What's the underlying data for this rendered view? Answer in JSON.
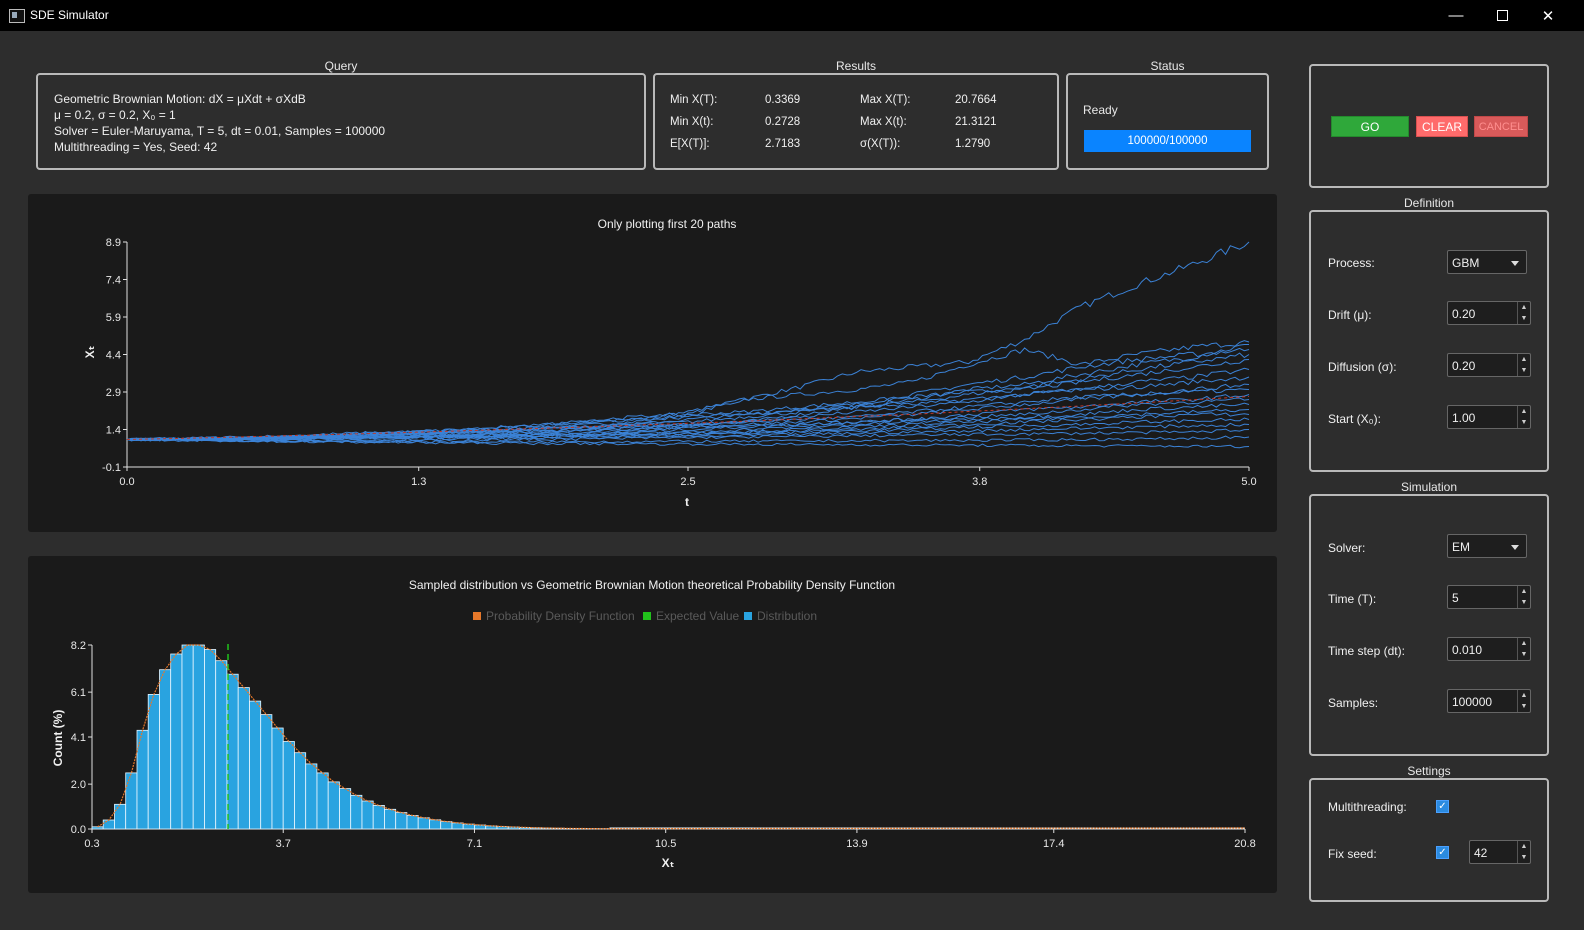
{
  "window": {
    "title": "SDE Simulator"
  },
  "query": {
    "title": "Query",
    "lines": [
      "Geometric Brownian Motion: dX = μXdt + σXdB",
      "μ = 0.2, σ = 0.2, X₀ = 1",
      "Solver = Euler-Maruyama, T = 5, dt = 0.01, Samples = 100000",
      "Multithreading = Yes, Seed: 42"
    ]
  },
  "results": {
    "title": "Results",
    "rows": [
      {
        "l1": "Min X(T):",
        "v1": "0.3369",
        "l2": "Max X(T):",
        "v2": "20.7664"
      },
      {
        "l1": "Min X(t):",
        "v1": "0.2728",
        "l2": "Max X(t):",
        "v2": "21.3121"
      },
      {
        "l1": "E[X(T)]:",
        "v1": "2.7183",
        "l2": "σ(X(T)):",
        "v2": "1.2790"
      }
    ]
  },
  "status": {
    "title": "Status",
    "text": "Ready",
    "progress_text": "100000/100000",
    "progress_fraction": 1.0
  },
  "buttons": {
    "go": "GO",
    "clear": "CLEAR",
    "cancel": "CANCEL"
  },
  "definition": {
    "title": "Definition",
    "process_label": "Process:",
    "process_value": "GBM",
    "drift_label": "Drift (μ):",
    "drift_value": "0.20",
    "diffusion_label": "Diffusion (σ):",
    "diffusion_value": "0.20",
    "start_label": "Start (X₀):",
    "start_value": "1.00"
  },
  "simulation": {
    "title": "Simulation",
    "solver_label": "Solver:",
    "solver_value": "EM",
    "time_label": "Time (T):",
    "time_value": "5",
    "dt_label": "Time step (dt):",
    "dt_value": "0.010",
    "samples_label": "Samples:",
    "samples_value": "100000"
  },
  "settings": {
    "title": "Settings",
    "mt_label": "Multithreading:",
    "mt_checked": true,
    "seed_label": "Fix seed:",
    "seed_checked": true,
    "seed_value": "42"
  },
  "colors": {
    "accent": "#0a84ff",
    "go": "#2fa83a",
    "clear": "#ff6b6b",
    "cancel": "#d95a5a",
    "path": "#3b82d6",
    "mean": "#c0392b",
    "hist": "#29a3e0",
    "pdf": "#e6782a",
    "expected": "#21c21b"
  },
  "chart_data": [
    {
      "type": "line",
      "title": "Only plotting first 20 paths",
      "xlabel": "t",
      "ylabel": "Xₜ",
      "xlim": [
        0.0,
        5.0
      ],
      "ylim": [
        -0.1,
        8.9
      ],
      "xticks": [
        "0.0",
        "1.3",
        "2.5",
        "3.8",
        "5.0"
      ],
      "yticks": [
        "-0.1",
        "1.4",
        "2.9",
        "4.4",
        "5.9",
        "7.4",
        "8.9"
      ],
      "x": [
        0,
        0.25,
        0.5,
        0.75,
        1,
        1.25,
        1.5,
        1.75,
        2,
        2.25,
        2.5,
        2.75,
        3,
        3.25,
        3.5,
        3.75,
        4,
        4.25,
        4.5,
        4.75,
        5
      ],
      "series": [
        {
          "values": [
            1,
            1.02,
            1.05,
            1.1,
            1.2,
            1.22,
            1.3,
            1.4,
            1.55,
            1.7,
            2.0,
            2.6,
            3.1,
            3.7,
            3.9,
            4.1,
            5.0,
            6.3,
            7.2,
            8.0,
            8.9
          ]
        },
        {
          "values": [
            1,
            1.03,
            1.08,
            1.12,
            1.18,
            1.28,
            1.35,
            1.45,
            1.6,
            1.8,
            2.1,
            2.6,
            2.8,
            3.0,
            3.3,
            4.0,
            4.6,
            4.0,
            4.4,
            4.7,
            4.9
          ]
        },
        {
          "values": [
            1,
            1.0,
            1.04,
            1.1,
            1.15,
            1.2,
            1.25,
            1.3,
            1.4,
            1.5,
            1.6,
            1.7,
            2.0,
            2.3,
            2.6,
            3.0,
            3.2,
            3.6,
            4.0,
            4.3,
            4.8
          ]
        },
        {
          "values": [
            1,
            1.02,
            1.06,
            1.1,
            1.2,
            1.25,
            1.3,
            1.35,
            1.5,
            1.6,
            1.8,
            2.0,
            2.2,
            2.4,
            2.8,
            3.2,
            3.5,
            3.9,
            4.2,
            4.4,
            4.6
          ]
        },
        {
          "values": [
            1,
            1.01,
            1.03,
            1.08,
            1.12,
            1.2,
            1.3,
            1.4,
            1.5,
            1.6,
            1.7,
            1.9,
            2.1,
            2.3,
            2.5,
            2.8,
            3.1,
            3.4,
            3.8,
            4.1,
            4.4
          ]
        },
        {
          "values": [
            1,
            1.04,
            1.1,
            1.15,
            1.25,
            1.3,
            1.4,
            1.5,
            1.7,
            1.9,
            2.0,
            2.1,
            2.3,
            2.5,
            2.7,
            2.9,
            3.0,
            3.3,
            3.6,
            3.9,
            4.2
          ]
        },
        {
          "values": [
            1,
            1.0,
            1.02,
            1.05,
            1.1,
            1.15,
            1.2,
            1.3,
            1.35,
            1.45,
            1.6,
            1.7,
            1.9,
            2.1,
            2.3,
            2.5,
            2.8,
            3.0,
            3.3,
            3.5,
            3.8
          ]
        },
        {
          "values": [
            1,
            1.02,
            1.05,
            1.1,
            1.2,
            1.3,
            1.4,
            1.55,
            1.7,
            1.8,
            1.9,
            2.0,
            2.2,
            2.3,
            2.4,
            2.6,
            2.8,
            3.0,
            3.1,
            3.3,
            3.5
          ]
        },
        {
          "values": [
            1,
            1.01,
            1.03,
            1.06,
            1.1,
            1.15,
            1.2,
            1.25,
            1.35,
            1.4,
            1.5,
            1.6,
            1.7,
            1.85,
            2.0,
            2.2,
            2.4,
            2.6,
            2.8,
            3.0,
            3.2
          ]
        },
        {
          "values": [
            1,
            1.03,
            1.07,
            1.1,
            1.2,
            1.25,
            1.3,
            1.4,
            1.5,
            1.55,
            1.6,
            1.7,
            1.8,
            1.9,
            2.1,
            2.3,
            2.5,
            2.7,
            2.8,
            2.9,
            3.0
          ]
        },
        {
          "values": [
            1,
            1.0,
            1.02,
            1.05,
            1.08,
            1.1,
            1.15,
            1.2,
            1.25,
            1.3,
            1.4,
            1.5,
            1.6,
            1.7,
            1.8,
            2.0,
            2.2,
            2.3,
            2.5,
            2.6,
            2.8
          ]
        },
        {
          "values": [
            1,
            1.02,
            1.04,
            1.07,
            1.1,
            1.12,
            1.15,
            1.2,
            1.3,
            1.4,
            1.5,
            1.55,
            1.6,
            1.7,
            1.8,
            1.9,
            2.0,
            2.2,
            2.4,
            2.5,
            2.6
          ]
        },
        {
          "values": [
            1,
            1.01,
            1.02,
            1.04,
            1.07,
            1.1,
            1.12,
            1.15,
            1.2,
            1.25,
            1.3,
            1.4,
            1.5,
            1.6,
            1.7,
            1.8,
            1.9,
            2.0,
            2.2,
            2.3,
            2.4
          ]
        },
        {
          "values": [
            1,
            1.02,
            1.03,
            1.05,
            1.08,
            1.1,
            1.12,
            1.15,
            1.2,
            1.22,
            1.25,
            1.3,
            1.4,
            1.5,
            1.6,
            1.7,
            1.8,
            1.9,
            2.0,
            2.1,
            2.2
          ]
        },
        {
          "values": [
            1,
            1.0,
            1.01,
            1.03,
            1.05,
            1.08,
            1.1,
            1.12,
            1.15,
            1.2,
            1.25,
            1.3,
            1.35,
            1.4,
            1.5,
            1.6,
            1.7,
            1.8,
            1.9,
            2.0,
            2.0
          ]
        },
        {
          "values": [
            1,
            1.01,
            1.02,
            1.03,
            1.04,
            1.06,
            1.08,
            1.1,
            1.12,
            1.15,
            1.2,
            1.25,
            1.3,
            1.35,
            1.4,
            1.5,
            1.55,
            1.6,
            1.7,
            1.75,
            1.8
          ]
        },
        {
          "values": [
            1,
            0.99,
            0.98,
            0.97,
            0.98,
            1.0,
            1.02,
            1.05,
            1.08,
            1.1,
            1.12,
            1.15,
            1.2,
            1.25,
            1.3,
            1.35,
            1.4,
            1.45,
            1.5,
            1.55,
            1.6
          ]
        },
        {
          "values": [
            1,
            0.98,
            0.96,
            0.95,
            0.94,
            0.95,
            0.97,
            1.0,
            1.02,
            1.05,
            1.08,
            1.1,
            1.12,
            1.15,
            1.18,
            1.2,
            1.22,
            1.25,
            1.28,
            1.3,
            1.4
          ]
        },
        {
          "values": [
            1,
            0.97,
            0.95,
            0.93,
            0.92,
            0.91,
            0.9,
            0.9,
            0.91,
            0.92,
            0.92,
            0.93,
            0.94,
            0.95,
            0.96,
            0.97,
            0.98,
            1.0,
            1.02,
            1.05,
            1.1
          ]
        },
        {
          "values": [
            1,
            0.98,
            0.95,
            0.92,
            0.9,
            0.88,
            0.86,
            0.85,
            0.84,
            0.83,
            0.82,
            0.81,
            0.8,
            0.79,
            0.78,
            0.77,
            0.76,
            0.75,
            0.74,
            0.73,
            0.72
          ]
        }
      ],
      "mean": [
        1,
        1.05,
        1.1,
        1.16,
        1.22,
        1.28,
        1.35,
        1.42,
        1.49,
        1.57,
        1.65,
        1.73,
        1.82,
        1.92,
        2.01,
        2.12,
        2.23,
        2.34,
        2.46,
        2.59,
        2.72
      ]
    },
    {
      "type": "bar",
      "title": "Sampled distribution vs Geometric Brownian Motion theoretical Probability Density Function",
      "xlabel": "Xₜ",
      "ylabel": "Count (%)",
      "xlim": [
        0.3,
        20.8
      ],
      "ylim": [
        0.0,
        8.2
      ],
      "xticks": [
        "0.3",
        "3.7",
        "7.1",
        "10.5",
        "13.9",
        "17.4",
        "20.8"
      ],
      "yticks": [
        "0.0",
        "2.0",
        "4.1",
        "6.1",
        "8.2"
      ],
      "legend": [
        "Probability Density Function",
        "Expected Value",
        "Distribution"
      ],
      "legend_position": "top-center",
      "bin_start": 0.3,
      "bin_width": 0.2,
      "values": [
        0.1,
        0.4,
        1.1,
        2.5,
        4.4,
        6.0,
        7.1,
        7.8,
        8.2,
        8.2,
        8.0,
        7.5,
        6.9,
        6.3,
        5.7,
        5.1,
        4.5,
        3.9,
        3.4,
        2.9,
        2.5,
        2.1,
        1.8,
        1.5,
        1.25,
        1.05,
        0.88,
        0.73,
        0.6,
        0.5,
        0.41,
        0.33,
        0.27,
        0.22,
        0.18,
        0.14,
        0.11,
        0.09,
        0.07,
        0.055,
        0.045,
        0.035,
        0.028,
        0.022,
        0.017,
        0.013
      ],
      "expected_value": 2.7183
    }
  ]
}
